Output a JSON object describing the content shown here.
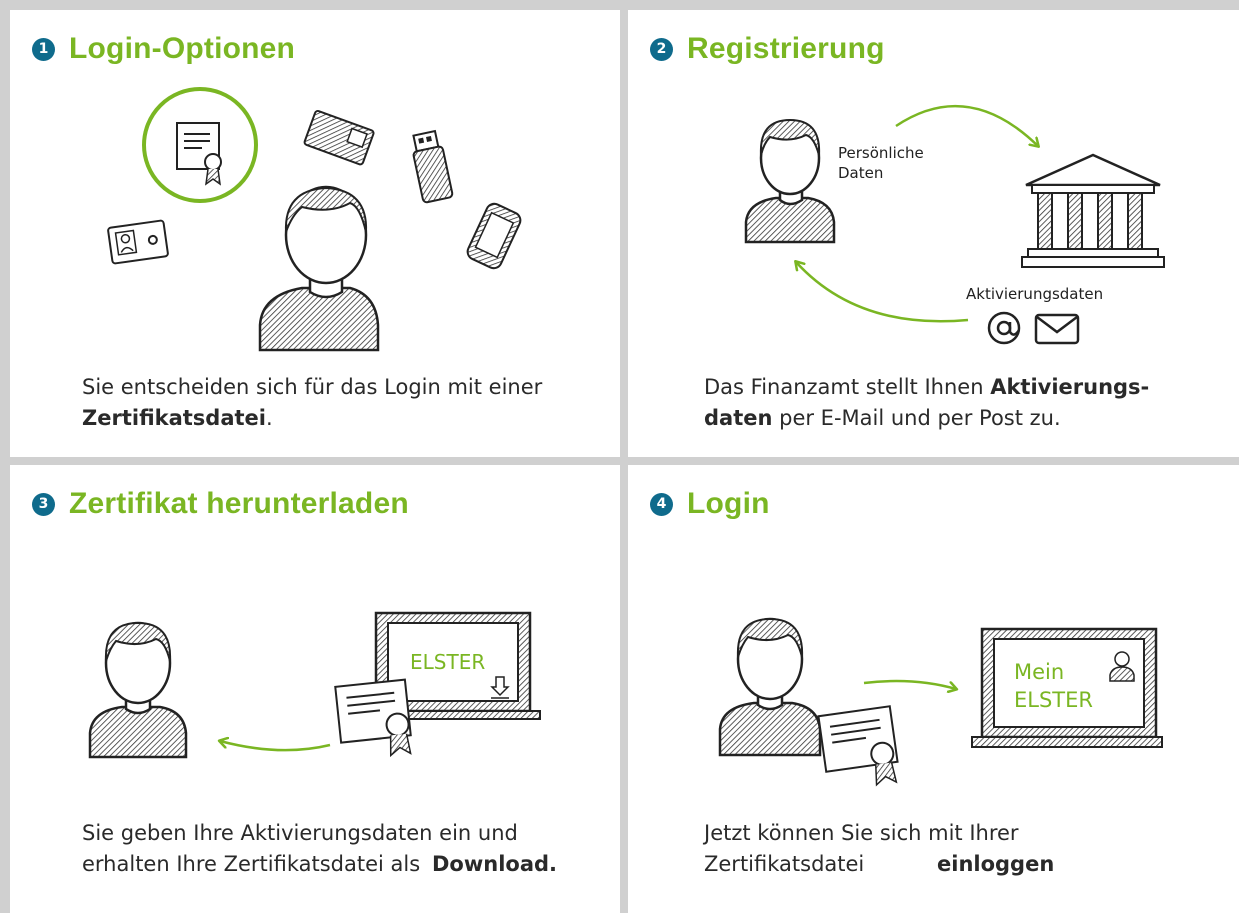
{
  "colors": {
    "green": "#7ab623",
    "blue": "#0f6b8c",
    "text": "#2a2a2a"
  },
  "panels": [
    {
      "number": "1",
      "title": "Login-Optionen",
      "desc_a": "Sie entscheiden sich für das Login mit einer ",
      "desc_b": "Zertifikatsdatei",
      "desc_c": "."
    },
    {
      "number": "2",
      "title": "Registrierung",
      "label_personal_1": "Persönliche",
      "label_personal_2": "Daten",
      "label_activation": "Aktivierungsdaten",
      "desc_a": "Das Finanzamt stellt Ihnen ",
      "desc_b": "Aktivierungs-daten",
      "desc_c": " per E-Mail und per Post zu."
    },
    {
      "number": "3",
      "title": "Zertifikat herunterladen",
      "screen_text": "ELSTER",
      "desc_a": "Sie geben Ihre Aktivierungsdaten ein und erhalten Ihre Zertifikatsdatei als ",
      "desc_b": "Download."
    },
    {
      "number": "4",
      "title": "Login",
      "screen_text_1": "Mein",
      "screen_text_2": "ELSTER",
      "desc_a": "Jetzt können Sie sich mit Ihrer Zertifikatsdatei ",
      "desc_b": "einloggen",
      "desc_c": "."
    }
  ]
}
